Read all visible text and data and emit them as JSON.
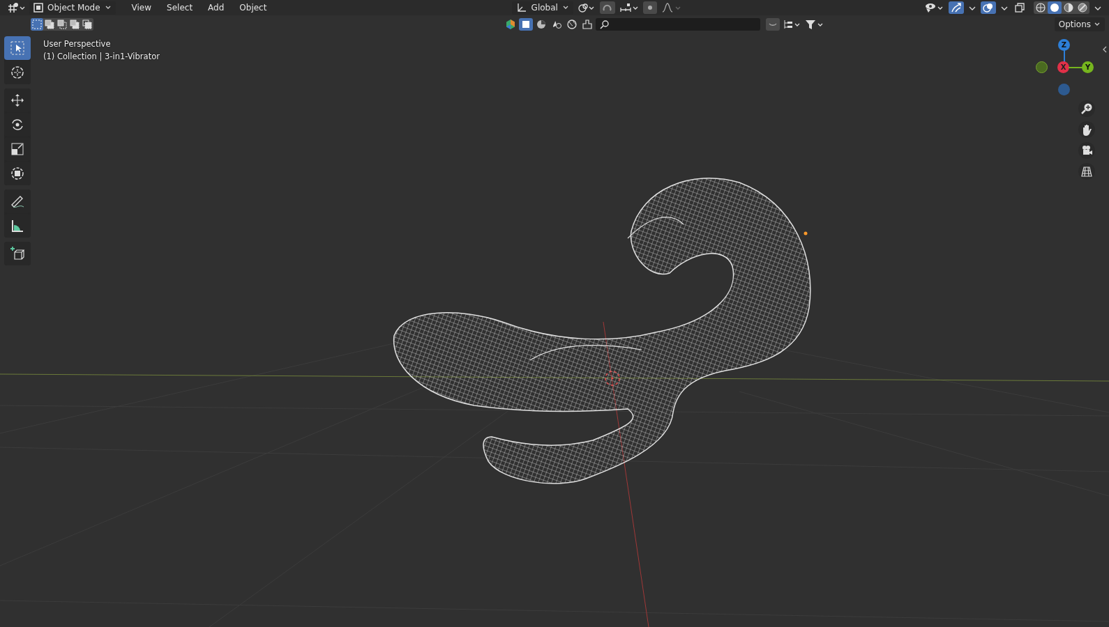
{
  "header": {
    "mode": "Object Mode",
    "menus": [
      {
        "label": "View"
      },
      {
        "label": "Select"
      },
      {
        "label": "Add"
      },
      {
        "label": "Object"
      }
    ],
    "orientation": "Global"
  },
  "select_modes": [
    {
      "selected": true
    },
    {
      "selected": false
    },
    {
      "selected": false
    },
    {
      "selected": false
    },
    {
      "selected": false
    }
  ],
  "shading_modes": [
    {
      "selected": false
    },
    {
      "selected": true
    },
    {
      "selected": false
    },
    {
      "selected": false
    }
  ],
  "options": "Options",
  "overlay": {
    "view_name": "User Perspective",
    "object_info": "(1) Collection | 3-in1-Vibrator"
  },
  "tools": [
    {
      "kind": "select",
      "selected": true
    },
    {
      "kind": "cursor",
      "selected": false
    },
    {
      "kind": "move",
      "selected": false
    },
    {
      "kind": "rotate",
      "selected": false
    },
    {
      "kind": "scale",
      "selected": false
    },
    {
      "kind": "transform",
      "selected": false
    },
    {
      "kind": "annotate",
      "selected": false
    },
    {
      "kind": "measure",
      "selected": false
    },
    {
      "kind": "add-cube",
      "selected": false
    }
  ],
  "gizmo": {
    "z": "Z",
    "x": "X",
    "y": "Y"
  }
}
